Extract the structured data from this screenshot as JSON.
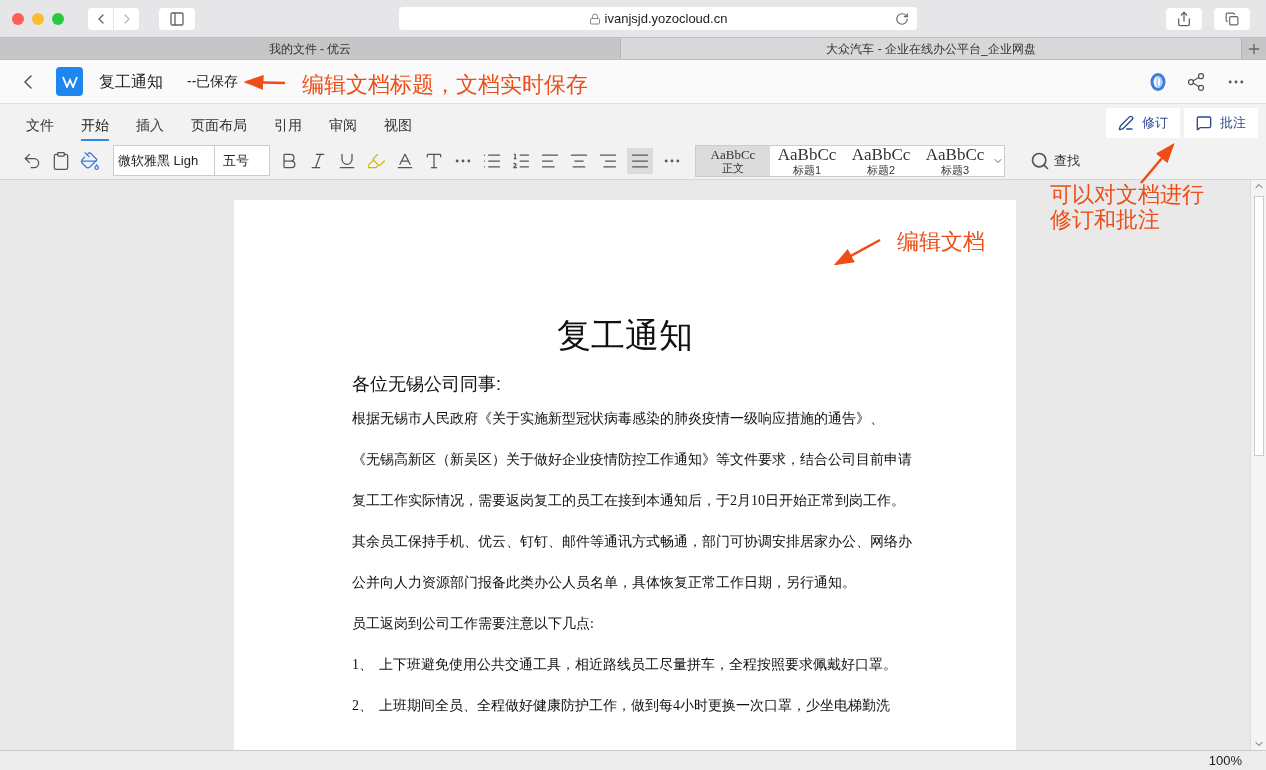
{
  "browser": {
    "url": "ivanjsjd.yozocloud.cn",
    "tabs": [
      {
        "label": "我的文件 - 优云",
        "selected": false
      },
      {
        "label": "大众汽车 - 企业在线办公平台_企业网盘",
        "selected": true
      }
    ]
  },
  "header": {
    "title": "复工通知",
    "status": "--已保存"
  },
  "ribbon_tabs": [
    {
      "label": "文件",
      "selected": false
    },
    {
      "label": "开始",
      "selected": true
    },
    {
      "label": "插入",
      "selected": false
    },
    {
      "label": "页面布局",
      "selected": false
    },
    {
      "label": "引用",
      "selected": false
    },
    {
      "label": "审阅",
      "selected": false
    },
    {
      "label": "视图",
      "selected": false
    }
  ],
  "review_buttons": [
    {
      "kind": "revise",
      "label": "修订"
    },
    {
      "kind": "comment",
      "label": "批注"
    }
  ],
  "toolbar": {
    "font": "微软雅黑 Ligh",
    "size": "五号",
    "find": "查找",
    "styles": [
      {
        "preview": "AaBbCc",
        "label": "正文",
        "selected": true
      },
      {
        "preview": "AaBbCc",
        "label": "标题1",
        "selected": false
      },
      {
        "preview": "AaBbCc",
        "label": "标题2",
        "selected": false
      },
      {
        "preview": "AaBbCc",
        "label": "标题3",
        "selected": false
      }
    ]
  },
  "document": {
    "title": "复工通知",
    "salutation": "各位无锡公司同事:",
    "lines": [
      "根据无锡市人民政府《关于实施新型冠状病毒感染的肺炎疫情一级响应措施的通告》、",
      "《无锡高新区（新吴区）关于做好企业疫情防控工作通知》等文件要求，结合公司目前申请",
      "复工工作实际情况，需要返岗复工的员工在接到本通知后，于2月10日开始正常到岗工作。",
      "其余员工保持手机、优云、钉钉、邮件等通讯方式畅通，部门可协调安排居家办公、网络办",
      "公并向人力资源部门报备此类办公人员名单，具体恢复正常工作日期，另行通知。",
      "员工返岗到公司工作需要注意以下几点:"
    ],
    "items": [
      {
        "number": "1、",
        "text": "上下班避免使用公共交通工具，相近路线员工尽量拼车，全程按照要求佩戴好口罩。"
      },
      {
        "number": "2、",
        "text": "上班期间全员、全程做好健康防护工作，做到每4小时更换一次口罩，少坐电梯勤洗"
      }
    ]
  },
  "status_bar": {
    "zoom": "100%"
  },
  "annotations": [
    {
      "kind": "title",
      "text": "编辑文档标题，文档实时保存"
    },
    {
      "kind": "doc",
      "text": "编辑文档"
    },
    {
      "kind": "review",
      "text": "可以对文档进行修订和批注"
    }
  ]
}
